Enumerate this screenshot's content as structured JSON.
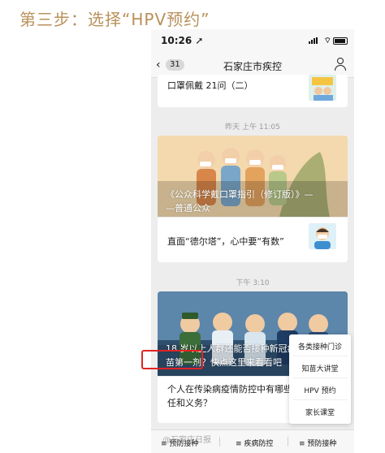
{
  "caption": "第三步：选择“HPV预约”",
  "status": {
    "time": "10:26",
    "location_icon": "location-arrow-icon"
  },
  "nav": {
    "back_count": "31",
    "title": "石家庄市疾控"
  },
  "feed": {
    "item1": {
      "title": "口罩佩戴 21问（二）"
    },
    "time1": "昨天 上午 11:05",
    "article1": {
      "hero_title_line1": "《公众科学戴口罩指引（修订版）》—",
      "hero_title_line2": "—普通公众",
      "sub_title": "直面“德尔塔”，心中要“有数”"
    },
    "time2": "下午 3:10",
    "article2": {
      "hero_title_line1": "18 岁以上人群还能否接种新冠疫",
      "hero_title_line2": "苗第一剂？快点这里来看看吧",
      "sub_title_line1": "个人在传染病疫情防控中有哪些",
      "sub_title_line2": "任和义务？"
    }
  },
  "popup_menu": {
    "items": [
      "各类接种门诊",
      "知苗大讲堂",
      "HPV 预约",
      "家长课堂"
    ],
    "highlight_color": "#e02424"
  },
  "tabbar": {
    "tab1": "预防接种",
    "tab2": "疾病防控",
    "tab3": "预防接种"
  },
  "watermark": "@石家庄日报"
}
